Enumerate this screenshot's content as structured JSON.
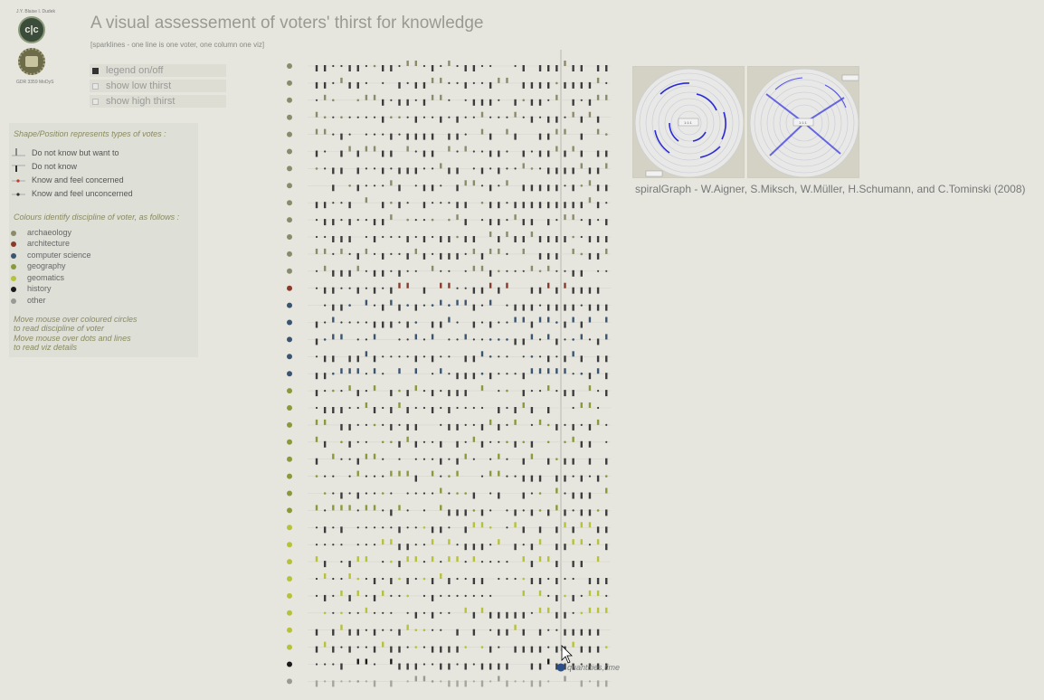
{
  "header": {
    "logo_text": "J.Y. Blaise  I. Dudek",
    "logo_mark": "c|c",
    "logo_caption": "GDR 3359 MoDyS",
    "title": "A visual assessement of voters' thirst for knowledge",
    "subtitle": "[sparklines - one line is one voter, one column one viz]"
  },
  "toggles": [
    {
      "label": "legend on/off",
      "checked": true
    },
    {
      "label": "show low thirst",
      "checked": false
    },
    {
      "label": "show high thirst",
      "checked": false
    }
  ],
  "legend": {
    "shape_header": "Shape/Position represents types of votes :",
    "vote_types": [
      {
        "label": "Do not know but want to",
        "icon": "tall-bar-up"
      },
      {
        "label": "Do not know",
        "icon": "tall-bar"
      },
      {
        "label": "Know and feel concerned",
        "icon": "red-dot-line"
      },
      {
        "label": "Know and feel unconcerned",
        "icon": "dot-line"
      }
    ],
    "colour_header": "Colours identify discipline of voter, as follows :",
    "disciplines": [
      {
        "label": "archaeology",
        "color": "#8b8b6c"
      },
      {
        "label": "architecture",
        "color": "#8b3a2a"
      },
      {
        "label": "computer science",
        "color": "#3b5570"
      },
      {
        "label": "geography",
        "color": "#8a9a3a"
      },
      {
        "label": "geomatics",
        "color": "#b5c23a"
      },
      {
        "label": "history",
        "color": "#1a1a1a"
      },
      {
        "label": "other",
        "color": "#9a9a94"
      }
    ],
    "hint1_l1": "Move mouse over coloured circles",
    "hint1_l2": "to read discipline of voter",
    "hint2_l1": "Move mouse over dots and lines",
    "hint2_l2": "to read viz details"
  },
  "viz": {
    "voter_disciplines": [
      0,
      0,
      0,
      0,
      0,
      0,
      0,
      0,
      0,
      0,
      0,
      0,
      0,
      1,
      2,
      2,
      2,
      2,
      2,
      3,
      3,
      3,
      3,
      3,
      3,
      3,
      3,
      4,
      4,
      4,
      4,
      4,
      4,
      4,
      4,
      5,
      6
    ],
    "columns": 36,
    "seed": 7
  },
  "spiral": {
    "thumb1_label": "1:1:1",
    "thumb2_label": "1:1:1"
  },
  "credit": "spiralGraph - W.Aigner, S.Miksch, W.Müller, H.Schumann, and C.Tominski (2008)",
  "cursor_label": "quantities,time",
  "cursor_color": "#2c4f8a"
}
